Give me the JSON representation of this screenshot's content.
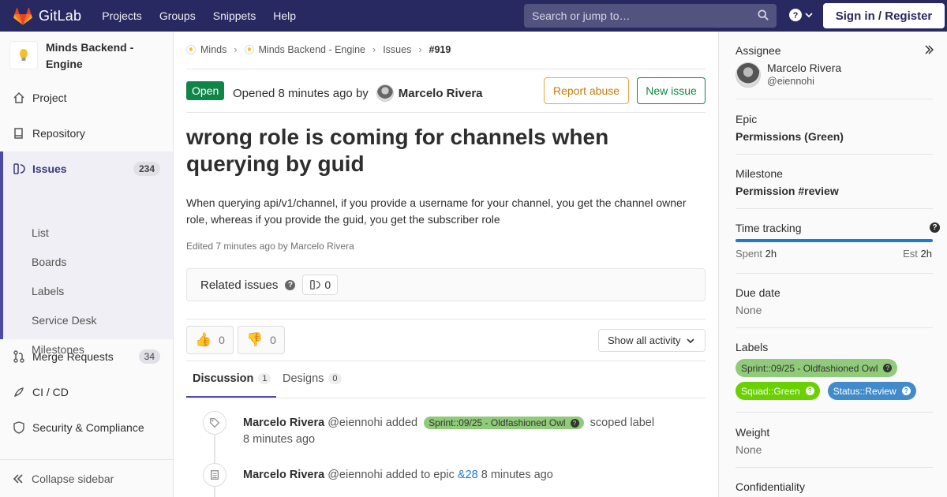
{
  "colors": {
    "navbar": "#292961",
    "accent": "#4b4ba3",
    "open_status": "#108548",
    "label_sprint": "#8fcb78",
    "label_squad": "#69d100",
    "label_status": "#428bca",
    "progress": "#1f78d1"
  },
  "topbar": {
    "brand": "GitLab",
    "nav": [
      "Projects",
      "Groups",
      "Snippets",
      "Help"
    ],
    "search_placeholder": "Search or jump to…",
    "sign_in": "Sign in / Register"
  },
  "sidebar": {
    "project_name": "Minds Backend - Engine",
    "items": {
      "project": "Project",
      "repository": "Repository",
      "issues": "Issues",
      "issues_count": "234",
      "merge_requests": "Merge Requests",
      "merge_requests_count": "34",
      "cicd": "CI / CD",
      "security": "Security & Compliance"
    },
    "sub_items": [
      "List",
      "Boards",
      "Labels",
      "Service Desk",
      "Milestones"
    ],
    "collapse": "Collapse sidebar"
  },
  "breadcrumb": [
    "Minds",
    "Minds Backend - Engine",
    "Issues",
    "#919"
  ],
  "issue": {
    "status": "Open",
    "opened_prefix": "Opened 8 minutes ago by",
    "author": "Marcelo Rivera",
    "report_abuse": "Report abuse",
    "new_issue": "New issue",
    "title": "wrong role is coming for channels when querying by guid",
    "description": "When querying api/v1/channel, if you provide a username for your channel, you get the channel owner role, whereas if you provide the guid, you get the subscriber role",
    "edited": "Edited 7 minutes ago by Marcelo Rivera",
    "related_label": "Related issues",
    "related_count": "0",
    "thumbs_up": "0",
    "thumbs_down": "0",
    "activity_filter": "Show all activity",
    "tabs": {
      "discussion": "Discussion",
      "discussion_count": "1",
      "designs": "Designs",
      "designs_count": "0"
    }
  },
  "notes": [
    {
      "author": "Marcelo Rivera",
      "handle": "@eiennohi",
      "action": "added",
      "label": "Sprint::09/25 - Oldfashioned Owl",
      "suffix": "scoped label",
      "time": "8 minutes ago"
    },
    {
      "author": "Marcelo Rivera",
      "handle": "@eiennohi",
      "action": "added to epic",
      "epic": "&28",
      "time": "8 minutes ago"
    }
  ],
  "right": {
    "assignee_title": "Assignee",
    "assignee_name": "Marcelo Rivera",
    "assignee_handle": "@eiennohi",
    "epic_title": "Epic",
    "epic_value": "Permissions (Green)",
    "milestone_title": "Milestone",
    "milestone_value": "Permission #review",
    "time_title": "Time tracking",
    "spent_label": "Spent",
    "spent_value": "2h",
    "est_label": "Est",
    "est_value": "2h",
    "progress": 1.0,
    "due_title": "Due date",
    "due_value": "None",
    "labels_title": "Labels",
    "labels": [
      "Sprint::09/25 - Oldfashioned Owl",
      "Squad::Green",
      "Status::Review"
    ],
    "weight_title": "Weight",
    "weight_value": "None",
    "confidentiality_title": "Confidentiality"
  }
}
